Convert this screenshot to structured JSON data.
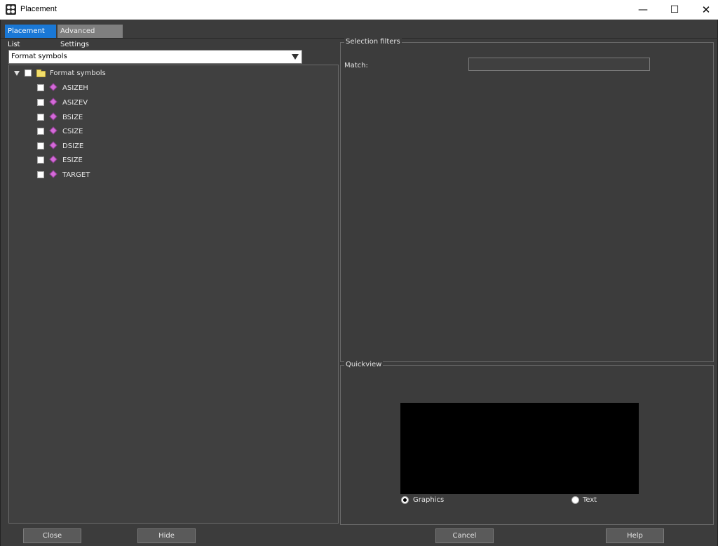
{
  "window": {
    "title": "Placement",
    "minimize_glyph": "—",
    "maximize_glyph": "☐",
    "close_glyph": "✕"
  },
  "tabs": [
    {
      "label": "Placement List",
      "active": true
    },
    {
      "label": "Advanced Settings",
      "active": false
    }
  ],
  "list_source": {
    "selected": "Format symbols"
  },
  "tree": {
    "root": {
      "label": "Format symbols",
      "icon": "folder-icon",
      "expanded": true,
      "checked": false
    },
    "items": [
      {
        "label": "ASIZEH",
        "icon": "symbol-icon",
        "checked": false
      },
      {
        "label": "ASIZEV",
        "icon": "symbol-icon",
        "checked": false
      },
      {
        "label": "BSIZE",
        "icon": "symbol-icon",
        "checked": false
      },
      {
        "label": "CSIZE",
        "icon": "symbol-icon",
        "checked": false
      },
      {
        "label": "DSIZE",
        "icon": "symbol-icon",
        "checked": false
      },
      {
        "label": "ESIZE",
        "icon": "symbol-icon",
        "checked": false
      },
      {
        "label": "TARGET",
        "icon": "symbol-icon",
        "checked": false
      }
    ]
  },
  "selection_filters": {
    "title": "Selection filters",
    "match_label": "Match:",
    "match_value": ""
  },
  "quickview": {
    "title": "Quickview",
    "options": [
      {
        "label": "Graphics",
        "selected": true
      },
      {
        "label": "Text",
        "selected": false
      }
    ]
  },
  "buttons": {
    "close": "Close",
    "hide": "Hide",
    "cancel": "Cancel",
    "help": "Help"
  },
  "colors": {
    "background": "#3c3c3c",
    "active_tab": "#1a78d6",
    "inactive_tab": "#7f7f7f",
    "symbol_icon": "#d46ad8",
    "folder_icon": "#f2de6b"
  }
}
